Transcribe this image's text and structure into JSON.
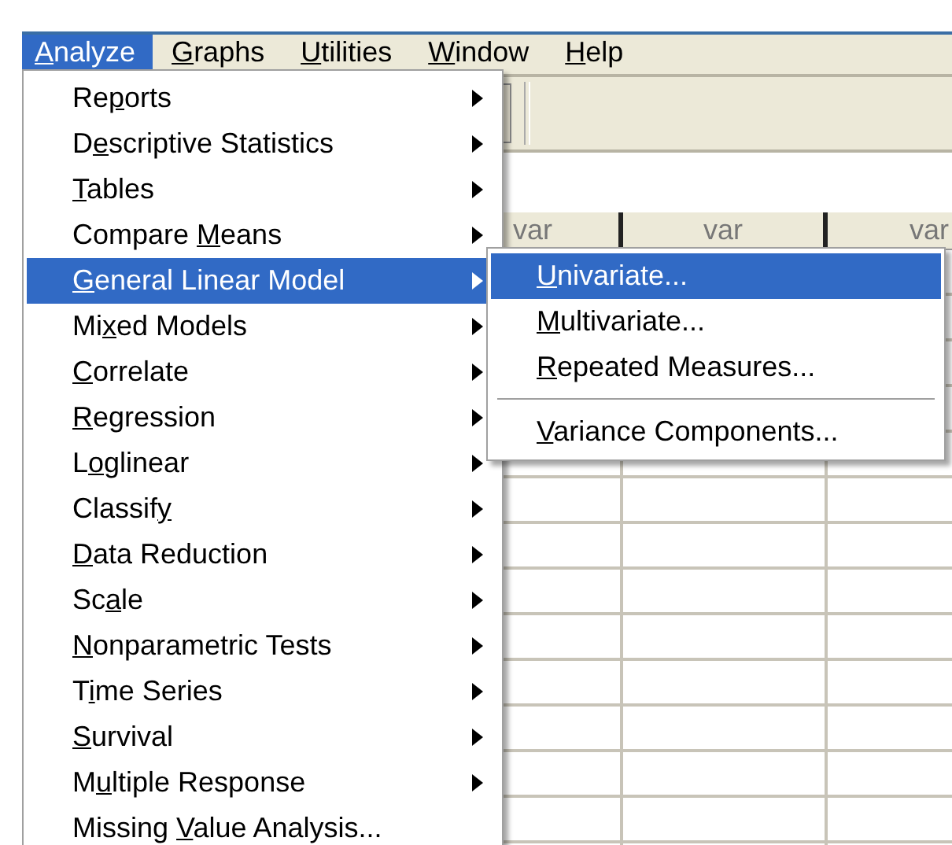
{
  "menubar": [
    {
      "label": {
        "key": "A",
        "post": "nalyze"
      },
      "selected": true
    },
    {
      "label": {
        "key": "G",
        "post": "raphs"
      },
      "selected": false
    },
    {
      "label": {
        "key": "U",
        "post": "tilities"
      },
      "selected": false
    },
    {
      "label": {
        "key": "W",
        "post": "indow"
      },
      "selected": false
    },
    {
      "label": {
        "key": "H",
        "post": "elp"
      },
      "selected": false
    }
  ],
  "analyze_menu": [
    {
      "label": {
        "pre": "Re",
        "key": "p",
        "post": "orts"
      },
      "submenu": true,
      "selected": false
    },
    {
      "label": {
        "pre": "D",
        "key": "e",
        "post": "scriptive Statistics"
      },
      "submenu": true,
      "selected": false
    },
    {
      "label": {
        "key": "T",
        "post": "ables"
      },
      "submenu": true,
      "selected": false
    },
    {
      "label": {
        "pre": "Compare ",
        "key": "M",
        "post": "eans"
      },
      "submenu": true,
      "selected": false
    },
    {
      "label": {
        "key": "G",
        "post": "eneral Linear Model"
      },
      "submenu": true,
      "selected": true
    },
    {
      "label": {
        "pre": "Mi",
        "key": "x",
        "post": "ed Models"
      },
      "submenu": true,
      "selected": false
    },
    {
      "label": {
        "key": "C",
        "post": "orrelate"
      },
      "submenu": true,
      "selected": false
    },
    {
      "label": {
        "key": "R",
        "post": "egression"
      },
      "submenu": true,
      "selected": false
    },
    {
      "label": {
        "pre": "L",
        "key": "o",
        "post": "glinear"
      },
      "submenu": true,
      "selected": false
    },
    {
      "label": {
        "pre": "Classif",
        "key": "y"
      },
      "submenu": true,
      "selected": false
    },
    {
      "label": {
        "key": "D",
        "post": "ata Reduction"
      },
      "submenu": true,
      "selected": false
    },
    {
      "label": {
        "pre": "Sc",
        "key": "a",
        "post": "le"
      },
      "submenu": true,
      "selected": false
    },
    {
      "label": {
        "key": "N",
        "post": "onparametric Tests"
      },
      "submenu": true,
      "selected": false
    },
    {
      "label": {
        "pre": "T",
        "key": "i",
        "post": "me Series"
      },
      "submenu": true,
      "selected": false
    },
    {
      "label": {
        "key": "S",
        "post": "urvival"
      },
      "submenu": true,
      "selected": false
    },
    {
      "label": {
        "pre": "M",
        "key": "u",
        "post": "ltiple Response"
      },
      "submenu": true,
      "selected": false
    },
    {
      "label": {
        "pre": "Missing ",
        "key": "V",
        "post": "alue Analysis..."
      },
      "submenu": false,
      "selected": false
    }
  ],
  "glm_submenu": [
    {
      "kind": "item",
      "label": {
        "key": "U",
        "post": "nivariate..."
      },
      "selected": true
    },
    {
      "kind": "item",
      "label": {
        "key": "M",
        "post": "ultivariate..."
      },
      "selected": false
    },
    {
      "kind": "item",
      "label": {
        "key": "R",
        "post": "epeated Measures..."
      },
      "selected": false
    },
    {
      "kind": "separator"
    },
    {
      "kind": "item",
      "label": {
        "key": "V",
        "post": "ariance Components..."
      },
      "selected": false
    }
  ],
  "grid": {
    "columns": [
      "var",
      "var",
      "var"
    ]
  }
}
